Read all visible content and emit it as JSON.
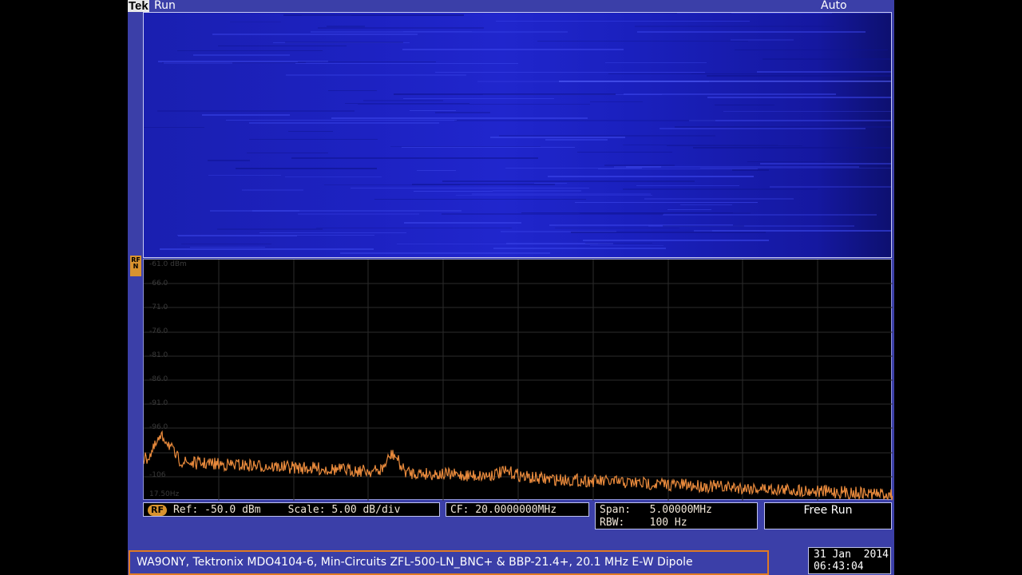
{
  "header": {
    "brand": "Tek",
    "run_state": "Run",
    "trigger_mode": "Auto"
  },
  "rf_channel_marker": "RF N",
  "spectrum": {
    "y_axis_labels": [
      "-61.0 dBm",
      "-66.0",
      "-71.0",
      "-76.0",
      "-81.0",
      "-86.0",
      "-91.0",
      "-96.0",
      "-106",
      "17.50Hz"
    ],
    "trace_color": "#e98a3c",
    "spectrogram_color": "#1d22c2"
  },
  "readouts": {
    "rf_badge": "RF",
    "ref": "Ref: -50.0 dBm",
    "scale": "Scale: 5.00 dB/div",
    "cf": "CF: 20.0000000MHz",
    "span": "Span:   5.00000MHz",
    "rbw": "RBW:    100 Hz",
    "trigger": "Free Run"
  },
  "note": "WA9ONY, Tektronix MDO4104-6, Min-Circuits ZFL-500-LN_BNC+ & BBP-21.4+, 20.1 MHz E-W Dipole",
  "datetime": {
    "date": "31 Jan  2014",
    "time": "06:43:04"
  }
}
